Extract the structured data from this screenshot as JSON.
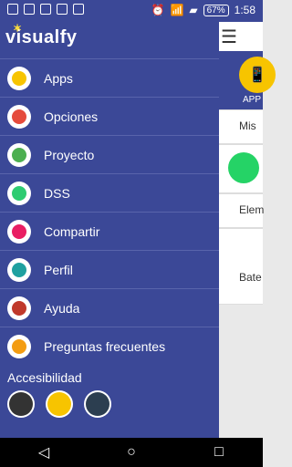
{
  "status": {
    "battery": "67%",
    "time": "1:58"
  },
  "app": {
    "name": "visualfy"
  },
  "menu": [
    {
      "label": "Apps",
      "icon": "phone-icon",
      "color": "#f7c400"
    },
    {
      "label": "Opciones",
      "icon": "wrench-icon",
      "color": "#e54b3c"
    },
    {
      "label": "Proyecto",
      "icon": "pencil-icon",
      "color": "#4caf50"
    },
    {
      "label": "DSS",
      "icon": "keyboard-icon",
      "color": "#2ecc71"
    },
    {
      "label": "Compartir",
      "icon": "share-icon",
      "color": "#e91e63"
    },
    {
      "label": "Perfil",
      "icon": "person-icon",
      "color": "#1fa0a0"
    },
    {
      "label": "Ayuda",
      "icon": "info-icon",
      "color": "#c0392b"
    },
    {
      "label": "Preguntas frecuentes",
      "icon": "question-icon",
      "color": "#f39c12"
    }
  ],
  "accessibility": {
    "title": "Accesibilidad",
    "options": [
      {
        "icon": "sign-language-icon",
        "color": "#333333"
      },
      {
        "icon": "spain-flag-icon",
        "color": "#f7c400"
      },
      {
        "icon": "uk-flag-icon",
        "color": "#2c3e50"
      }
    ]
  },
  "content": {
    "app_label": "APP",
    "card1_text": "Mis",
    "card2_text": "Elem",
    "card3_text": "Bate"
  }
}
